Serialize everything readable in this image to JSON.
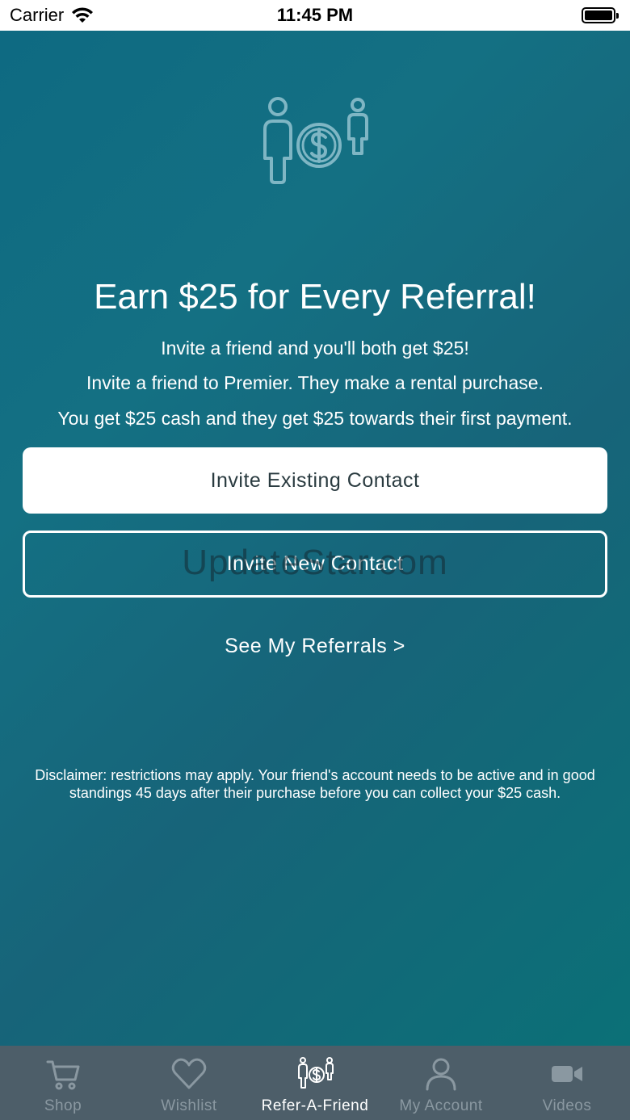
{
  "status_bar": {
    "carrier": "Carrier",
    "time": "11:45 PM"
  },
  "hero": {
    "icon": "refer-money-icon",
    "headline": "Earn $25 for Every Referral!",
    "lines": [
      "Invite a friend and you'll both get $25!",
      "Invite a friend to Premier.  They make a rental purchase.",
      "You get $25 cash and they get $25 towards their first payment."
    ]
  },
  "actions": {
    "invite_existing_label": "Invite Existing Contact",
    "invite_new_label": "Invite New Contact",
    "see_referrals_label": "See My Referrals >"
  },
  "watermark": "UpdateStar.com",
  "disclaimer": "Disclaimer: restrictions may apply. Your friend's account needs to be active and in good standings 45 days after their purchase before you can collect your $25 cash.",
  "tabs": [
    {
      "label": "Shop",
      "icon": "cart-icon",
      "active": false
    },
    {
      "label": "Wishlist",
      "icon": "heart-icon",
      "active": false
    },
    {
      "label": "Refer-A-Friend",
      "icon": "refer-icon",
      "active": true
    },
    {
      "label": "My Account",
      "icon": "person-icon",
      "active": false
    },
    {
      "label": "Videos",
      "icon": "video-camera-icon",
      "active": false
    }
  ],
  "colors": {
    "background_start": "#0e6a82",
    "background_end": "#0b7077",
    "tab_bar": "#4d5e69",
    "tab_inactive": "#8a98a1",
    "icon_tint": "#7fb6c4"
  }
}
